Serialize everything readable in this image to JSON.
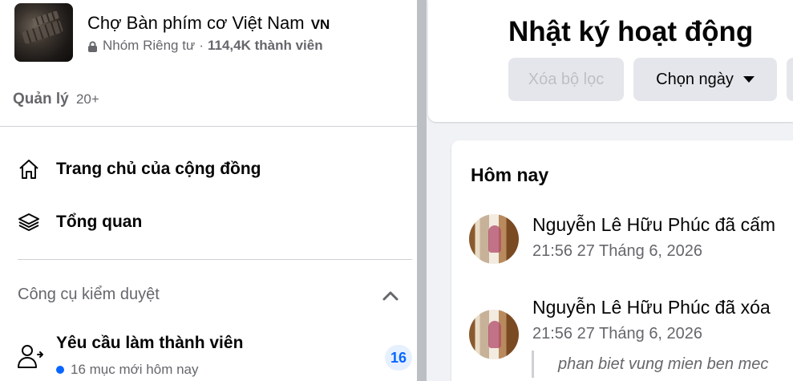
{
  "group": {
    "name": "Chợ Bàn phím cơ Việt Nam",
    "country_code": "VN",
    "privacy": "Nhóm Riêng tư",
    "separator": "·",
    "members": "114,4K thành viên"
  },
  "admin": {
    "label": "Quản lý",
    "count": "20+"
  },
  "nav": {
    "community_home": "Trang chủ của cộng đồng",
    "overview": "Tổng quan"
  },
  "moderation": {
    "title": "Công cụ kiểm duyệt",
    "member_requests": {
      "label": "Yêu cầu làm thành viên",
      "subtitle": "16 mục mới hôm nay",
      "badge": "16"
    }
  },
  "activity_log": {
    "title": "Nhật ký hoạt động",
    "clear_filter": "Xóa bộ lọc",
    "choose_date": "Chọn ngày",
    "section_today": "Hôm nay",
    "entries": [
      {
        "text": "Nguyễn Lê Hữu Phúc đã cấm",
        "time": "21:56 27 Tháng 6, 2026"
      },
      {
        "text": "Nguyễn Lê Hữu Phúc đã xóa",
        "time": "21:56 27 Tháng 6, 2026"
      }
    ],
    "quote": "phan biet vung mien ben mec"
  },
  "colors": {
    "accent": "#0866ff",
    "secondary_text": "#65676b",
    "button_bg": "#e4e6eb",
    "page_bg": "#f0f2f5"
  }
}
